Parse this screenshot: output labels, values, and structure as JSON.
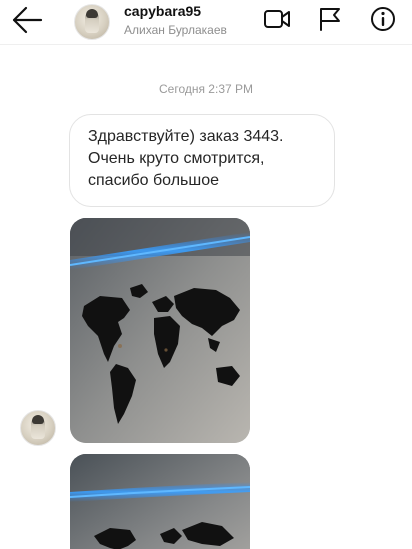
{
  "header": {
    "username": "capybara95",
    "full_name": "Алихан Бурлакаев",
    "icons": {
      "back": "back-arrow-icon",
      "video": "video-call-icon",
      "flag": "flag-icon",
      "info": "info-icon"
    }
  },
  "thread": {
    "timestamp": "Сегодня 2:37 PM",
    "message": {
      "lines": [
        "Здравствуйте) заказ 3443.",
        "Очень круто смотрится,",
        "спасибо большое"
      ]
    },
    "photos": [
      {
        "description": "photo-wall-world-map-1"
      },
      {
        "description": "photo-wall-world-map-2"
      }
    ]
  },
  "colors": {
    "text_primary": "#262626",
    "text_secondary": "#8e8e8e",
    "bubble_border": "#e3e3e3",
    "led_glow": "#2a8cff"
  }
}
